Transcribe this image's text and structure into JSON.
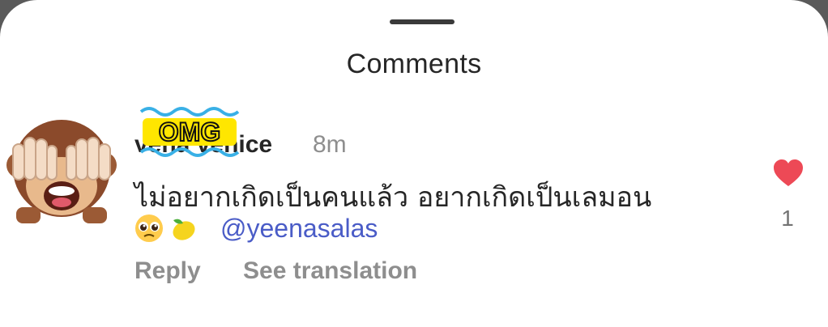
{
  "sheet": {
    "title": "Comments"
  },
  "comment": {
    "author": "vena venice",
    "time": "8m",
    "text": "ไม่อยากเกิดเป็นคนแล้ว อยากเกิดเป็นเลมอน",
    "emojis": [
      "pleading-face",
      "lemon"
    ],
    "mention": "@yeenasalas",
    "like_count": "1",
    "avatar_icon": "see-no-evil-monkey"
  },
  "sticker": {
    "text": "OMG"
  },
  "actions": {
    "reply_label": "Reply",
    "translate_label": "See translation"
  },
  "colors": {
    "like": "#ed4956",
    "mention": "#4a5cc7",
    "secondary": "#8e8e8e"
  }
}
